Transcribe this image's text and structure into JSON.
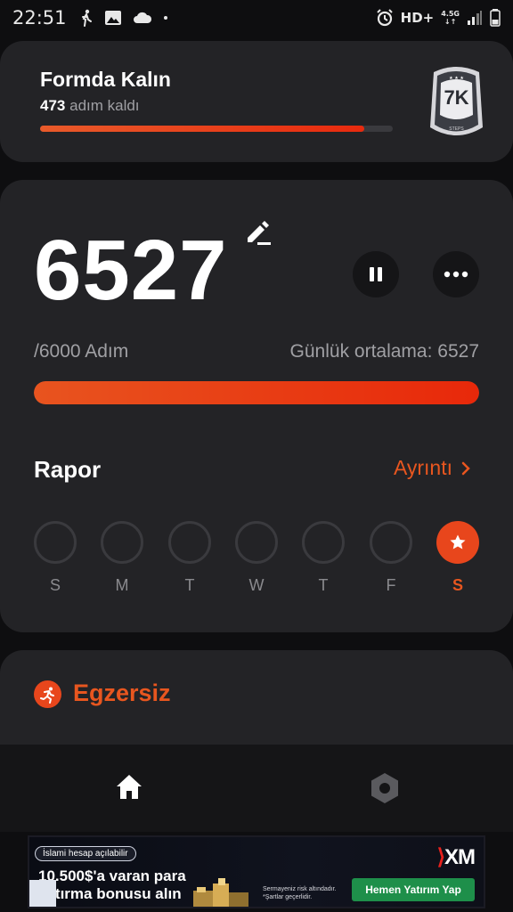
{
  "status_bar": {
    "time": "22:51",
    "network": "HD+",
    "network_type": "4.5G",
    "icons": [
      "walk-icon",
      "image-icon",
      "cloud-icon",
      "dot-icon",
      "alarm-icon",
      "signal-icon",
      "battery-icon"
    ]
  },
  "goal_card": {
    "title": "Formda Kalın",
    "remaining_value": "473",
    "remaining_label": "adım kaldı",
    "progress": 0.92,
    "badge_text": "7K",
    "badge_sub": "STEPS",
    "badge_stars": "★ ★ ★"
  },
  "steps_card": {
    "step_count": "6527",
    "target": "/6000 Adım",
    "average": "Günlük ortalama: 6527",
    "progress": 1.0,
    "report_title": "Rapor",
    "report_link": "Ayrıntı",
    "days": [
      {
        "label": "S",
        "active": false
      },
      {
        "label": "M",
        "active": false
      },
      {
        "label": "T",
        "active": false
      },
      {
        "label": "W",
        "active": false
      },
      {
        "label": "T",
        "active": false
      },
      {
        "label": "F",
        "active": false
      },
      {
        "label": "S",
        "active": true
      }
    ]
  },
  "exercise_card": {
    "title": "Egzersiz"
  },
  "bottom_nav": {
    "items": [
      "home-icon",
      "settings-icon"
    ]
  },
  "ad": {
    "pill": "İslami hesap açılabilir",
    "headline_line1": "10.500$'a varan para",
    "headline_line2": "yatırma bonusu alın",
    "logo": "XM",
    "disclaimer_line1": "Sermayeniz risk altındadır.",
    "disclaimer_line2": "*Şartlar geçerlidir.",
    "cta": "Hemen Yatırım Yap"
  },
  "colors": {
    "accent": "#e8561f",
    "card": "#232326",
    "background": "#0e0e10",
    "cta_green": "#1e8f4a"
  }
}
